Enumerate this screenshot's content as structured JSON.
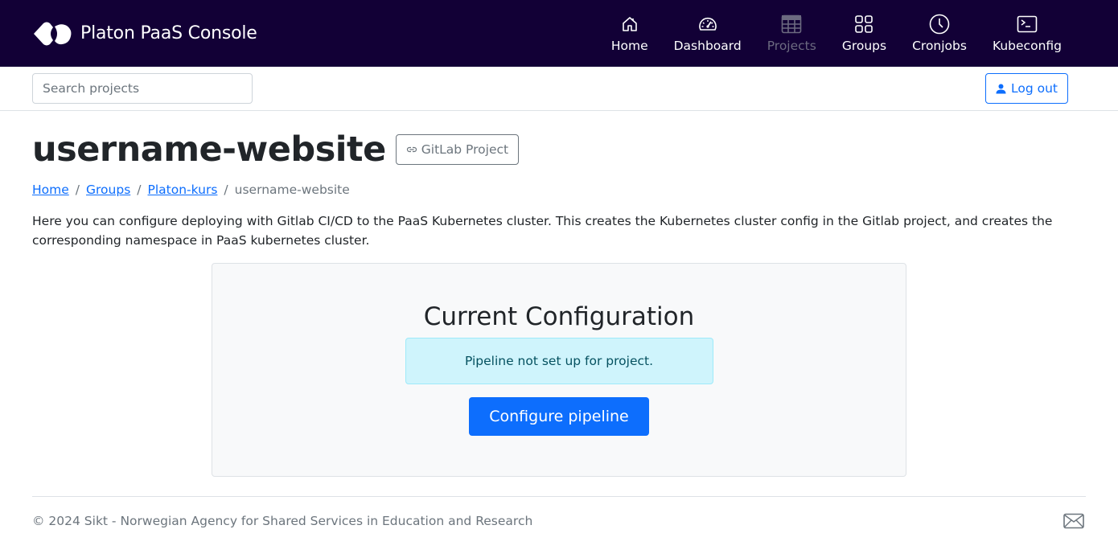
{
  "app": {
    "title": "Platon PaaS Console"
  },
  "nav": {
    "items": [
      {
        "label": "Home",
        "icon": "home-icon",
        "active": false
      },
      {
        "label": "Dashboard",
        "icon": "speedometer-icon",
        "active": false
      },
      {
        "label": "Projects",
        "icon": "table-icon",
        "active": true
      },
      {
        "label": "Groups",
        "icon": "grid-icon",
        "active": false
      },
      {
        "label": "Cronjobs",
        "icon": "clock-icon",
        "active": false
      },
      {
        "label": "Kubeconfig",
        "icon": "terminal-icon",
        "active": false
      }
    ]
  },
  "subbar": {
    "search_placeholder": "Search projects",
    "search_value": "",
    "logout_label": "Log out"
  },
  "page": {
    "title": "username-website",
    "gitlab_button_label": "GitLab Project",
    "breadcrumb": [
      {
        "label": "Home",
        "link": true
      },
      {
        "label": "Groups",
        "link": true
      },
      {
        "label": "Platon-kurs",
        "link": true
      },
      {
        "label": "username-website",
        "link": false
      }
    ],
    "breadcrumb_separator": "/",
    "intro": "Here you can configure deploying with Gitlab CI/CD to the PaaS Kubernetes cluster. This creates the Kubernetes cluster config in the Gitlab project, and creates the corresponding namespace in PaaS kubernetes cluster."
  },
  "config": {
    "title": "Current Configuration",
    "status_message": "Pipeline not set up for project.",
    "button_label": "Configure pipeline"
  },
  "footer": {
    "text": "© 2024 Sikt - Norwegian Agency for Shared Services in Education and Research",
    "icon": "mail-icon"
  },
  "colors": {
    "navbar_bg": "#120036",
    "primary": "#0d6efd",
    "alert_info_bg": "#cff4fc",
    "alert_info_text": "#055160",
    "muted": "#6c757d"
  }
}
